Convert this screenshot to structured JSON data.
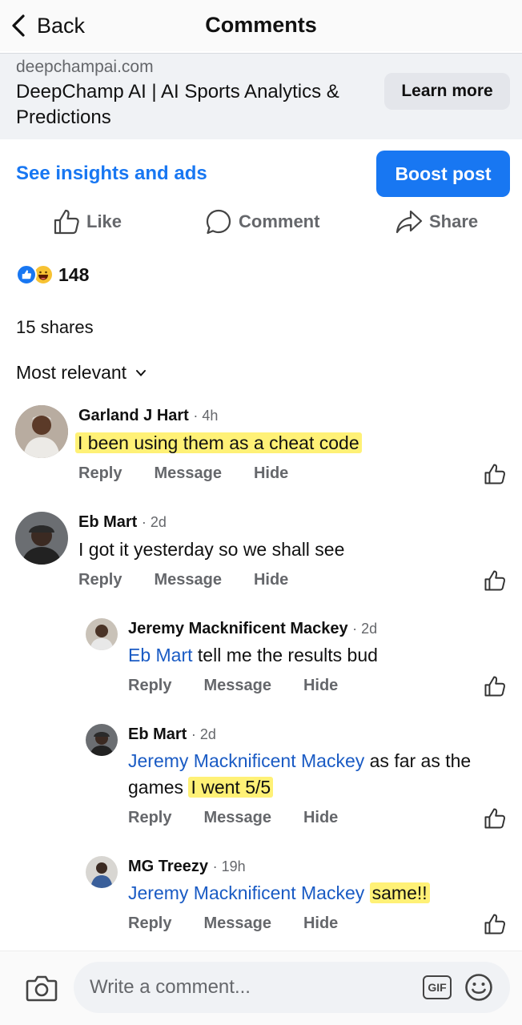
{
  "header": {
    "back_label": "Back",
    "title": "Comments"
  },
  "ad": {
    "domain": "deepchampai.com",
    "title": "DeepChamp AI | AI Sports Analytics & Predictions",
    "cta": "Learn more"
  },
  "insights_link": "See insights and ads",
  "boost_label": "Boost post",
  "actions": {
    "like": "Like",
    "comment": "Comment",
    "share": "Share"
  },
  "reactions": {
    "count": "148"
  },
  "shares": "15 shares",
  "sort_label": "Most relevant",
  "comment_actions": {
    "reply": "Reply",
    "message": "Message",
    "hide": "Hide"
  },
  "comments": [
    {
      "author": "Garland J Hart",
      "time": "· 4h",
      "text": "I been using them as a cheat code"
    },
    {
      "author": "Eb Mart",
      "time": "· 2d",
      "text": "I got it yesterday so we shall see",
      "replies": [
        {
          "author": "Jeremy Macknificent Mackey",
          "time": "· 2d",
          "mention": "Eb Mart",
          "text": "tell me the results bud"
        },
        {
          "author": "Eb Mart",
          "time": "· 2d",
          "mention": "Jeremy Macknificent Mackey",
          "text": "as far as the",
          "text2": "games",
          "highlight": "I went 5/5"
        },
        {
          "author": "MG Treezy",
          "time": "· 19h",
          "mention": "Jeremy Macknificent Mackey",
          "highlight": "same!!"
        }
      ]
    }
  ],
  "composer": {
    "placeholder": "Write a comment...",
    "gif_label": "GIF"
  },
  "colors": {
    "accent": "#1877f2",
    "mention": "#1a5bc4",
    "highlight": "#fff176",
    "muted": "#65676b"
  }
}
